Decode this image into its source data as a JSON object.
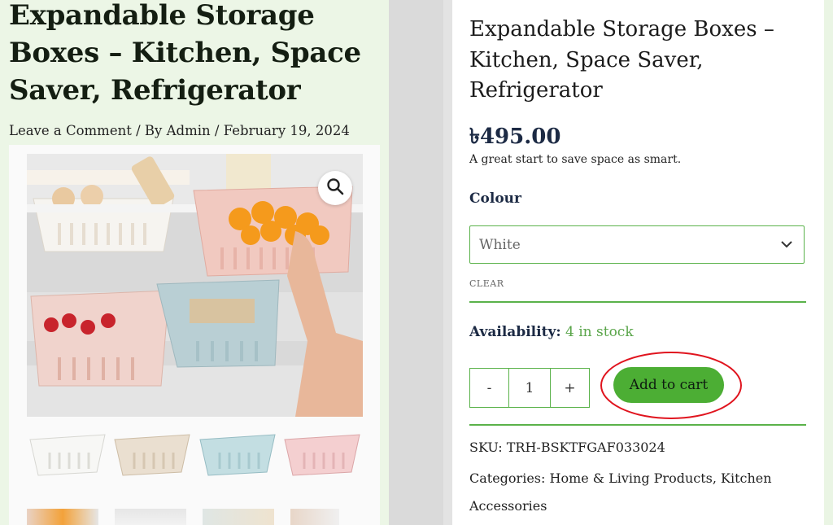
{
  "left": {
    "title": "Expandable Storage Boxes – Kitchen, Space Saver, Refrigerator",
    "meta": {
      "comment_link": "Leave a Comment",
      "sep1": " / By ",
      "author": "Admin",
      "sep2": " / ",
      "date": "February 19, 2024"
    },
    "zoom_icon": "magnifier-icon"
  },
  "product": {
    "title": "Expandable Storage Boxes – Kitchen, Space Saver, Refrigerator",
    "price": "৳495.00",
    "short_description": "A great start to save space as smart.",
    "colour_label": "Colour",
    "colour_selected": "White",
    "clear_label": "CLEAR",
    "availability_label": "Availability:",
    "availability_value": "4 in stock",
    "qty_minus": "-",
    "qty_value": "1",
    "qty_plus": "+",
    "add_to_cart": "Add to cart",
    "sku_label": "SKU:",
    "sku_value": "TRH-BSKTFGAF033024",
    "categories_label": "Categories:",
    "category_1": "Home & Living Products",
    "category_sep": ", ",
    "category_2": "Kitchen Accessories"
  },
  "colors": {
    "accent_green": "#4cae34",
    "border_green": "#5ab24a",
    "annotation_red": "#e0141e",
    "heading_navy": "#1c2a44"
  }
}
